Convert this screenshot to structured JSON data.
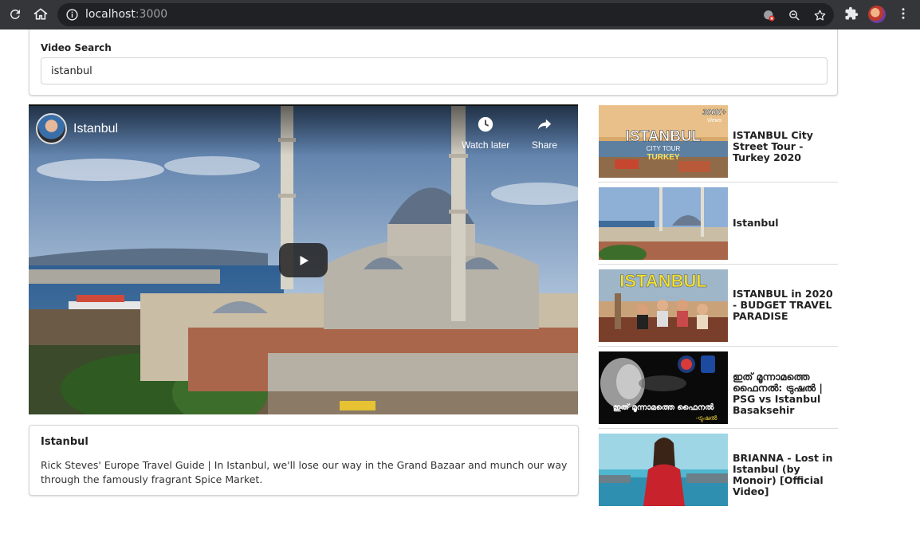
{
  "browser": {
    "url_host": "localhost",
    "url_port": ":3000"
  },
  "search": {
    "label": "Video Search",
    "value": "istanbul"
  },
  "player": {
    "title": "Istanbul",
    "watch_later": "Watch later",
    "share": "Share"
  },
  "details": {
    "title": "Istanbul",
    "description": "Rick Steves' Europe Travel Guide | In Istanbul, we'll lose our way in the Grand Bazaar and munch our way through the famously fragrant Spice Market."
  },
  "videos": [
    {
      "title": "ISTANBUL City Street Tour - Turkey 2020",
      "thumb_text": "ISTANBUL",
      "thumb_sub": "CITY TOUR",
      "thumb_sub2": "TURKEY",
      "badge": "300K+",
      "badge2": "Views"
    },
    {
      "title": "Istanbul"
    },
    {
      "title": "ISTANBUL in 2020 - BUDGET TRAVEL PARADISE",
      "thumb_text": "ISTANBUL"
    },
    {
      "title": "ഇത് മൂന്നാമത്തെ ഫൈനൽ: ട്രുഷൽ | PSG vs Istanbul Basaksehir",
      "thumb_text": "ഇത് മൂന്നാമത്തെ ഫൈനൽ",
      "thumb_sub": "-ട്രുഷൽ"
    },
    {
      "title": "BRIANNA - Lost in Istanbul (by Monoir) [Official Video]"
    }
  ],
  "colors": {
    "chrome": "#35363a",
    "omnibox": "#202124",
    "border": "#d4d4d5"
  }
}
